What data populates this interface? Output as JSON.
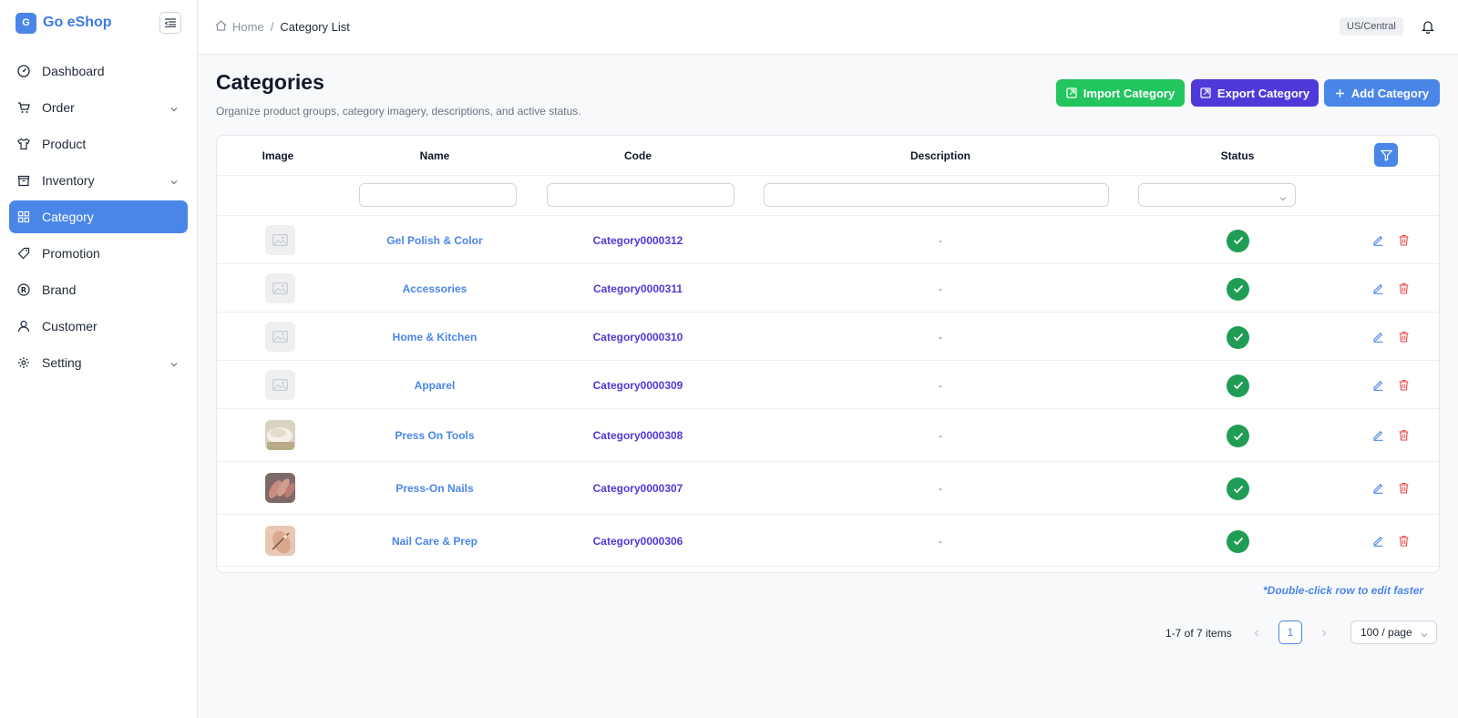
{
  "app": {
    "logo_letter": "G",
    "name": "Go eShop"
  },
  "sidebar": {
    "items": [
      {
        "label": "Dashboard",
        "icon": "dashboard-icon",
        "has_children": false,
        "active": false
      },
      {
        "label": "Order",
        "icon": "cart-icon",
        "has_children": true,
        "active": false
      },
      {
        "label": "Product",
        "icon": "shirt-icon",
        "has_children": false,
        "active": false
      },
      {
        "label": "Inventory",
        "icon": "box-icon",
        "has_children": true,
        "active": false
      },
      {
        "label": "Category",
        "icon": "grid-icon",
        "has_children": false,
        "active": true
      },
      {
        "label": "Promotion",
        "icon": "tag-icon",
        "has_children": false,
        "active": false
      },
      {
        "label": "Brand",
        "icon": "registered-icon",
        "has_children": false,
        "active": false
      },
      {
        "label": "Customer",
        "icon": "user-icon",
        "has_children": false,
        "active": false
      },
      {
        "label": "Setting",
        "icon": "gear-icon",
        "has_children": true,
        "active": false
      }
    ]
  },
  "header": {
    "breadcrumb": {
      "home": "Home",
      "separator": "/",
      "current": "Category List"
    },
    "timezone": "US/Central"
  },
  "main": {
    "title": "Categories",
    "subtitle": "Organize product groups, category imagery, descriptions, and active status.",
    "buttons": {
      "import": "Import Category",
      "export": "Export Category",
      "add": "Add Category"
    }
  },
  "table": {
    "columns": {
      "image": "Image",
      "name": "Name",
      "code": "Code",
      "description": "Description",
      "status": "Status"
    },
    "rows": [
      {
        "name": "Gel Polish & Color",
        "code": "Category0000312",
        "description": "-",
        "image": "placeholder",
        "active": true
      },
      {
        "name": "Accessories",
        "code": "Category0000311",
        "description": "-",
        "image": "placeholder",
        "active": true
      },
      {
        "name": "Home & Kitchen",
        "code": "Category0000310",
        "description": "-",
        "image": "placeholder",
        "active": true
      },
      {
        "name": "Apparel",
        "code": "Category0000309",
        "description": "-",
        "image": "placeholder",
        "active": true
      },
      {
        "name": "Press On Tools",
        "code": "Category0000308",
        "description": "-",
        "image": "photo-tools",
        "active": true
      },
      {
        "name": "Press-On Nails",
        "code": "Category0000307",
        "description": "-",
        "image": "photo-nails",
        "active": true
      },
      {
        "name": "Nail Care & Prep",
        "code": "Category0000306",
        "description": "-",
        "image": "photo-care",
        "active": true
      }
    ]
  },
  "footer": {
    "hint": "*Double-click row to edit faster",
    "pagination": {
      "total": "1-7 of 7 items",
      "current_page": "1",
      "page_size": "100 / page"
    }
  },
  "colors": {
    "primary": "#4a86e8",
    "import": "#22c55e",
    "export": "#4f39d8",
    "status_active": "#1f9d55",
    "delete": "#ef4444"
  }
}
